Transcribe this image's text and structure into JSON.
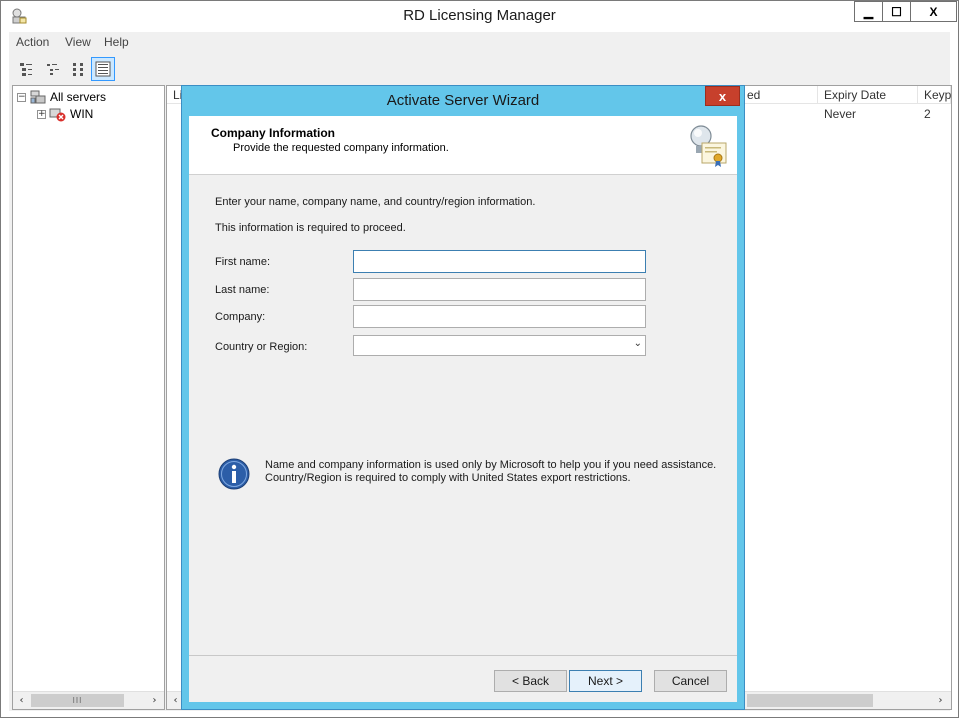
{
  "app": {
    "title": "RD Licensing Manager",
    "icon": "licensing-manager-icon",
    "controls": {
      "minimize": "▁",
      "maximize": "☐",
      "close": "X"
    }
  },
  "menu": [
    "Action",
    "View",
    "Help"
  ],
  "toolbar": {
    "buttons": [
      {
        "icon": "large-icons-view-icon",
        "active": false
      },
      {
        "icon": "small-icons-view-icon",
        "active": false
      },
      {
        "icon": "list-view-icon",
        "active": false
      },
      {
        "icon": "details-view-icon",
        "active": true
      }
    ]
  },
  "tree": {
    "root": {
      "label": "All servers",
      "expander": "−",
      "icon": "servers-icon"
    },
    "child": {
      "label": "WIN",
      "expander": "+",
      "icon": "server-error-icon"
    }
  },
  "list": {
    "columns": [
      "Li",
      "ed",
      "Expiry Date",
      "Keyp"
    ],
    "row": {
      "expiry": "Never",
      "keypacks": "2"
    }
  },
  "scrollbars": {
    "left": "‹",
    "right": "›",
    "thumb": "III"
  },
  "dialog": {
    "title": "Activate Server Wizard",
    "close": "x",
    "header": {
      "title": "Company Information",
      "subtitle": "Provide the requested company information.",
      "icon": "certificate-icon"
    },
    "intro": "Enter your name, company name, and country/region information.",
    "required_note": "This information is required to proceed.",
    "fields": {
      "first_name": {
        "label": "First name:",
        "value": ""
      },
      "last_name": {
        "label": "Last name:",
        "value": ""
      },
      "company": {
        "label": "Company:",
        "value": ""
      },
      "country": {
        "label": "Country or Region:",
        "value": ""
      }
    },
    "info": "Name and company information is used only by Microsoft to help you if you need assistance. Country/Region is required to comply with United States export restrictions.",
    "buttons": {
      "back": "< Back",
      "next": "Next >",
      "cancel": "Cancel"
    }
  },
  "colors": {
    "dialog_frame": "#63c6ea",
    "close_button": "#c7402c",
    "focus_border": "#3c7fb1",
    "selection": "#cce8ff"
  }
}
